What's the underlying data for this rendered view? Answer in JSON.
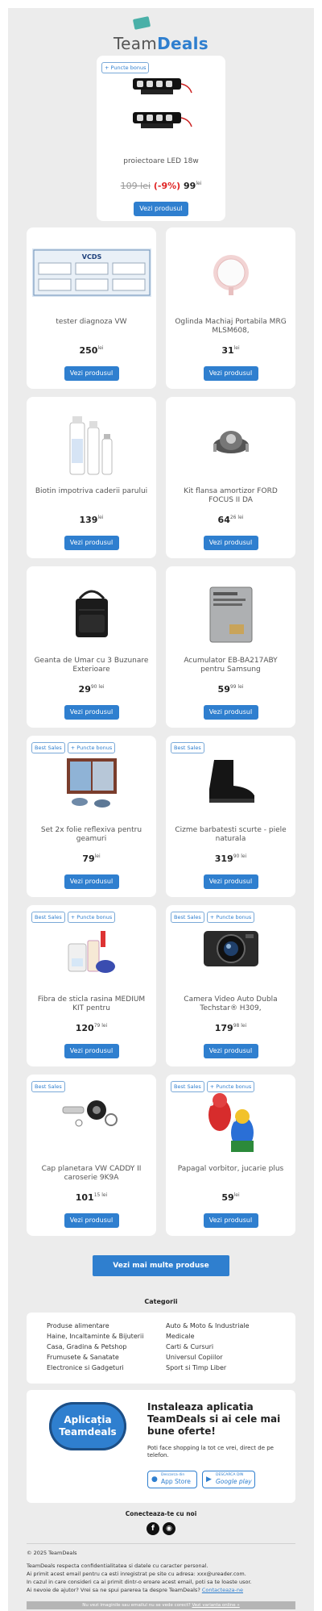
{
  "brand": {
    "name_a": "Team",
    "name_b": "Deals"
  },
  "featured": {
    "badges": [
      "+ Puncte bonus"
    ],
    "name": "proiectoare LED 18w",
    "price_old": "109 lei",
    "discount": "(-9%)",
    "price_int": "99",
    "price_cur": "lei",
    "button": "Vezi produsul"
  },
  "products": [
    {
      "badges": [],
      "name": "tester diagnoza VW",
      "price_int": "250",
      "price_sup": "lei",
      "button": "Vezi produsul",
      "img": "vcds-screenshot"
    },
    {
      "badges": [],
      "name": "Oglinda Machiaj Portabila MRG MLSM608,",
      "price_int": "31",
      "price_sup": "lei",
      "button": "Vezi produsul",
      "img": "mirror"
    },
    {
      "badges": [],
      "name": "Biotin impotriva caderii parului",
      "price_int": "139",
      "price_sup": "lei",
      "button": "Vezi produsul",
      "img": "bottles"
    },
    {
      "badges": [],
      "name": "Kit flansa amortizor FORD FOCUS II DA",
      "price_int": "64",
      "price_sup": "26 lei",
      "button": "Vezi produsul",
      "img": "mount"
    },
    {
      "badges": [],
      "name": "Geanta de Umar cu 3 Buzunare Exterioare",
      "price_int": "29",
      "price_sup": "90 lei",
      "button": "Vezi produsul",
      "img": "bag"
    },
    {
      "badges": [],
      "name": "Acumulator EB-BA217ABY pentru Samsung",
      "price_int": "59",
      "price_sup": "99 lei",
      "button": "Vezi produsul",
      "img": "battery"
    },
    {
      "badges": [
        "Best Sales",
        "+ Puncte bonus"
      ],
      "name": "Set 2x folie reflexiva pentru geamuri",
      "price_int": "79",
      "price_sup": "lei",
      "button": "Vezi produsul",
      "img": "window"
    },
    {
      "badges": [
        "Best Sales"
      ],
      "name": "Cizme barbatesti scurte - piele naturala",
      "price_int": "319",
      "price_sup": "90 lei",
      "button": "Vezi produsul",
      "img": "boot"
    },
    {
      "badges": [
        "Best Sales",
        "+ Puncte bonus"
      ],
      "name": "Fibra de sticla rasina MEDIUM KIT pentru",
      "price_int": "120",
      "price_sup": "79 lei",
      "button": "Vezi produsul",
      "img": "kit"
    },
    {
      "badges": [
        "Best Sales",
        "+ Puncte bonus"
      ],
      "name": "Camera Video Auto Dubla Techstar® H309,",
      "price_int": "179",
      "price_sup": "98 lei",
      "button": "Vezi produsul",
      "img": "camera"
    },
    {
      "badges": [
        "Best Sales"
      ],
      "name": "Cap planetara VW CADDY II caroserie 9K9A",
      "price_int": "101",
      "price_sup": "15 lei",
      "button": "Vezi produsul",
      "img": "cv-joint"
    },
    {
      "badges": [
        "Best Sales",
        "+ Puncte bonus"
      ],
      "name": "Papagal vorbitor, jucarie plus",
      "price_int": "59",
      "price_sup": "lei",
      "button": "Vezi produsul",
      "img": "parrot"
    }
  ],
  "more_button": "Vezi mai multe produse",
  "categories": {
    "title": "Categorii",
    "left": [
      "Produse alimentare",
      "Haine, Incaltaminte & Bijuterii",
      "Casa, Gradina & Petshop",
      "Frumusete & Sanatate",
      "Electronice si Gadgeturi"
    ],
    "right": [
      "Auto & Moto & Industriale",
      "Medicale",
      "Carti & Cursuri",
      "Universul Copiilor",
      "Sport si Timp Liber"
    ]
  },
  "app": {
    "pill_line1": "Aplicația",
    "pill_line2": "Teamdeals",
    "title": "Instaleaza aplicatia TeamDeals si ai cele mai bune oferte!",
    "text": "Poti face shopping la tot ce vrei, direct de pe telefon.",
    "appstore_small": "Descarca din",
    "appstore": "App Store",
    "gplay_small": "DESCARCA DIN",
    "gplay": "Google play"
  },
  "connect": "Conecteaza-te cu noi",
  "footer": {
    "copyright": "© 2025 TeamDeals",
    "line1": "TeamDeals respecta confidentialitatea si datele cu caracter personal.",
    "line2": "Ai primit acest email pentru ca esti inregistrat pe site cu adresa: xxx@ureader.com.",
    "line3": "In cazul in care consideri ca ai primit dintr-o eroare acest email, poti sa te loaste usor.",
    "line4_text": "Ai nevoie de ajutor? Vrei sa ne spui parerea ta despre TeamDeals?",
    "line4_link": "Contacteaza-ne",
    "bar_text": "Nu vezi imaginile sau emailul nu se vede corect?",
    "bar_link": "Vezi varianta online »"
  },
  "colors": {
    "accent": "#2f7fcf",
    "discount": "#e02424",
    "background": "#ececec"
  }
}
